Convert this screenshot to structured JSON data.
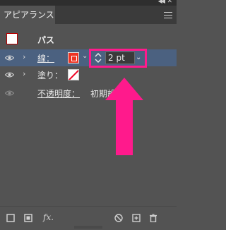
{
  "panel": {
    "tab_label": "アピアランス"
  },
  "path": {
    "label": "パス"
  },
  "rows": [
    {
      "label": "線：",
      "icon": "stroke-swatch"
    },
    {
      "label": "塗り：",
      "icon": "fill-swatch"
    },
    {
      "label": "不透明度：",
      "value": "初期設定"
    }
  ],
  "stroke": {
    "weight": "2 pt"
  },
  "colors": {
    "highlight": "#ff1a8c",
    "selected_row": "#4b6180",
    "stroke_color": "#ee3322"
  }
}
